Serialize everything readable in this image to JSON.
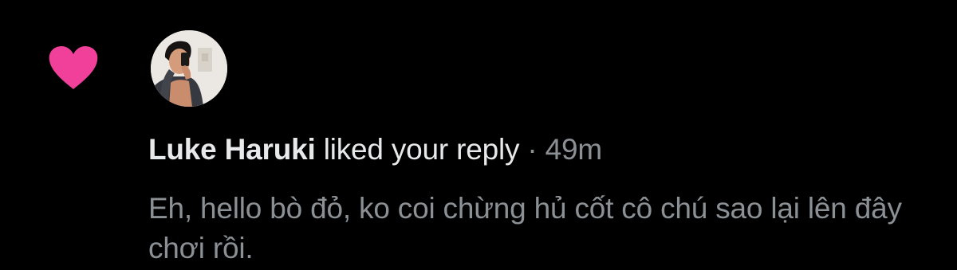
{
  "notification": {
    "type_icon": "heart-icon",
    "type_icon_color": "#f1409a",
    "avatar": "profile-photo",
    "user_name": "Luke Haruki",
    "action": "liked your reply",
    "separator": "·",
    "time_ago": "49m",
    "reply_text": "Eh, hello bò đỏ, ko coi chừng hủ cốt cô chú sao lại lên đây chơi rồi."
  },
  "colors": {
    "background": "#000000",
    "primary_text": "#e7e9ea",
    "secondary_text": "#8b9095",
    "like_pink": "#f1409a"
  }
}
